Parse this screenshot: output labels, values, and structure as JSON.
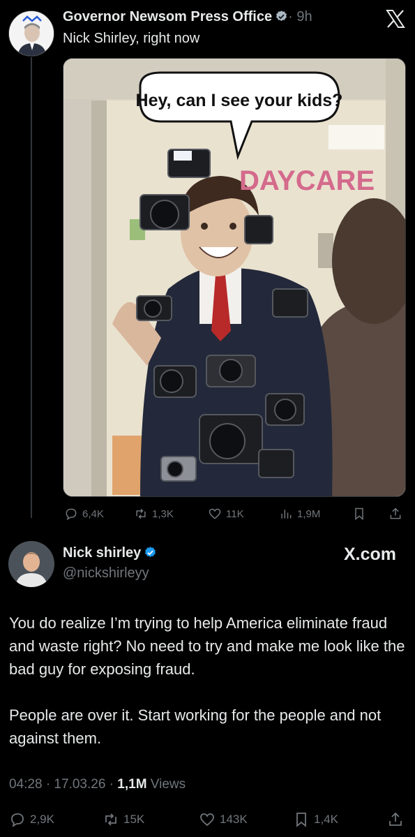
{
  "quoted": {
    "author_name": "Governor Newsom Press Office",
    "time": "· 9h",
    "text": "Nick Shirley, right now",
    "image": {
      "speech_bubble": "Hey, can I see your kids?",
      "sign": "DAYCARE"
    },
    "stats": {
      "replies": "6,4K",
      "reposts": "1,3K",
      "likes": "11K",
      "views": "1,9M"
    }
  },
  "reply": {
    "author_name": "Nick shirley",
    "handle": "@nickshirleyy",
    "watermark": "X.com",
    "paragraphs": [
      "You do realize I’m trying to help America eliminate fraud and waste right? No need to try and make me look like the bad guy for exposing fraud.",
      "People are over it. Start working for the people and not against them."
    ],
    "timestamp": "04:28 · 17.03.26 · ",
    "views_count": "1,1M",
    "views_label": " Views",
    "stats": {
      "replies": "2,9K",
      "reposts": "15K",
      "likes": "143K",
      "bookmarks": "1,4K"
    }
  },
  "colors": {
    "background": "#000000",
    "text": "#e7e9ea",
    "muted": "#71767b",
    "verified": "#1d9bf0"
  },
  "icons": [
    "x-logo-icon",
    "verified-icon",
    "reply-icon",
    "repost-icon",
    "like-icon",
    "views-icon",
    "bookmark-icon",
    "share-icon"
  ]
}
